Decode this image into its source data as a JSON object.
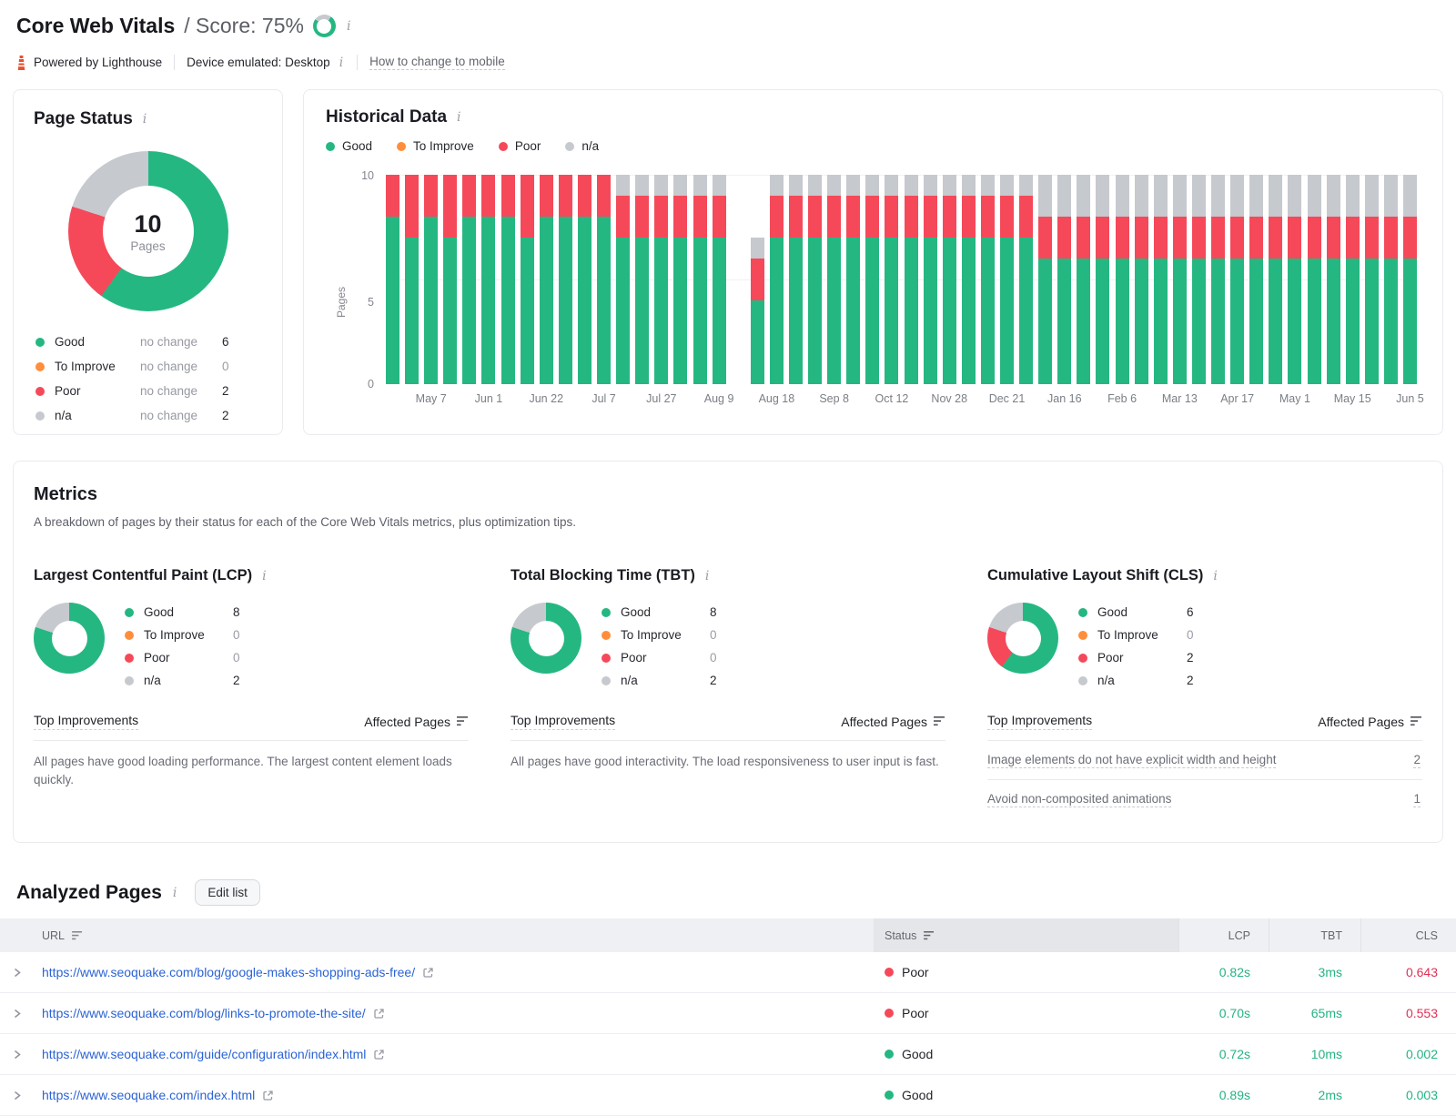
{
  "colors": {
    "good": "#25b782",
    "to_improve": "#ff8e3c",
    "poor": "#f5495a",
    "na": "#c6c9ce",
    "value_good": "#24b380",
    "value_poor": "#e03055",
    "link": "#2b63d4",
    "ring_track": "#d4d7db"
  },
  "header": {
    "title": "Core Web Vitals",
    "score_label": "/ Score: 75%",
    "score_percent": 75,
    "powered_by": "Powered by Lighthouse",
    "device": "Device emulated: Desktop",
    "mobile_link": "How to change to mobile"
  },
  "page_status": {
    "title": "Page Status",
    "legend": [
      {
        "status": "good",
        "label": "Good",
        "change": "no change",
        "value": "6"
      },
      {
        "status": "to_improve",
        "label": "To Improve",
        "change": "no change",
        "value": "0"
      },
      {
        "status": "poor",
        "label": "Poor",
        "change": "no change",
        "value": "2"
      },
      {
        "status": "na",
        "label": "n/a",
        "change": "no change",
        "value": "2"
      }
    ]
  },
  "historical": {
    "title": "Historical Data",
    "legend": [
      {
        "status": "good",
        "label": "Good"
      },
      {
        "status": "to_improve",
        "label": "To Improve"
      },
      {
        "status": "poor",
        "label": "Poor"
      },
      {
        "status": "na",
        "label": "n/a"
      }
    ]
  },
  "metrics": {
    "title": "Metrics",
    "subtitle": "A breakdown of pages by their status for each of the Core Web Vitals metrics, plus optimization tips.",
    "cards": [
      {
        "id": "lcp",
        "title": "Largest Contentful Paint (LCP)",
        "legend": [
          {
            "status": "good",
            "label": "Good",
            "value": "8"
          },
          {
            "status": "to_improve",
            "label": "To Improve",
            "value": "0"
          },
          {
            "status": "poor",
            "label": "Poor",
            "value": "0"
          },
          {
            "status": "na",
            "label": "n/a",
            "value": "2"
          }
        ],
        "improvements_header": "Top Improvements",
        "affected_header": "Affected Pages",
        "note": "All pages have good loading performance. The largest content element loads quickly.",
        "improvements": []
      },
      {
        "id": "tbt",
        "title": "Total Blocking Time (TBT)",
        "legend": [
          {
            "status": "good",
            "label": "Good",
            "value": "8"
          },
          {
            "status": "to_improve",
            "label": "To Improve",
            "value": "0"
          },
          {
            "status": "poor",
            "label": "Poor",
            "value": "0"
          },
          {
            "status": "na",
            "label": "n/a",
            "value": "2"
          }
        ],
        "improvements_header": "Top Improvements",
        "affected_header": "Affected Pages",
        "note": "All pages have good interactivity. The load responsiveness to user input is fast.",
        "improvements": []
      },
      {
        "id": "cls",
        "title": "Cumulative Layout Shift (CLS)",
        "legend": [
          {
            "status": "good",
            "label": "Good",
            "value": "6"
          },
          {
            "status": "to_improve",
            "label": "To Improve",
            "value": "0"
          },
          {
            "status": "poor",
            "label": "Poor",
            "value": "2"
          },
          {
            "status": "na",
            "label": "n/a",
            "value": "2"
          }
        ],
        "improvements_header": "Top Improvements",
        "affected_header": "Affected Pages",
        "note": null,
        "improvements": [
          {
            "label": "Image elements do not have explicit width and height",
            "pages": "2"
          },
          {
            "label": "Avoid non-composited animations",
            "pages": "1"
          }
        ]
      }
    ]
  },
  "analyzed": {
    "title": "Analyzed Pages",
    "edit_button": "Edit list",
    "columns": {
      "url": "URL",
      "status": "Status",
      "lcp": "LCP",
      "tbt": "TBT",
      "cls": "CLS"
    },
    "rows": [
      {
        "url": "https://www.seoquake.com/blog/google-makes-shopping-ads-free/",
        "status": "Poor",
        "status_tone": "poor",
        "lcp": "0.82s",
        "lcp_tone": "good",
        "tbt": "3ms",
        "tbt_tone": "good",
        "cls": "0.643",
        "cls_tone": "poor"
      },
      {
        "url": "https://www.seoquake.com/blog/links-to-promote-the-site/",
        "status": "Poor",
        "status_tone": "poor",
        "lcp": "0.70s",
        "lcp_tone": "good",
        "tbt": "65ms",
        "tbt_tone": "good",
        "cls": "0.553",
        "cls_tone": "poor"
      },
      {
        "url": "https://www.seoquake.com/guide/configuration/index.html",
        "status": "Good",
        "status_tone": "good",
        "lcp": "0.72s",
        "lcp_tone": "good",
        "tbt": "10ms",
        "tbt_tone": "good",
        "cls": "0.002",
        "cls_tone": "good"
      },
      {
        "url": "https://www.seoquake.com/index.html",
        "status": "Good",
        "status_tone": "good",
        "lcp": "0.89s",
        "lcp_tone": "good",
        "tbt": "2ms",
        "tbt_tone": "good",
        "cls": "0.003",
        "cls_tone": "good"
      }
    ]
  },
  "chart_data": {
    "score_ring": {
      "type": "pie",
      "segments": [
        {
          "status": "good",
          "label": "Score",
          "value": 75
        },
        {
          "status": "na",
          "label": "Remainder",
          "value": 25
        }
      ]
    },
    "page_status_donut": {
      "type": "pie",
      "title": "Page Status",
      "center_value": "10",
      "center_label": "Pages",
      "segments": [
        {
          "status": "good",
          "label": "Good",
          "value": 6
        },
        {
          "status": "to_improve",
          "label": "To Improve",
          "value": 0
        },
        {
          "status": "poor",
          "label": "Poor",
          "value": 2
        },
        {
          "status": "na",
          "label": "n/a",
          "value": 2
        }
      ]
    },
    "lcp_donut": {
      "type": "pie",
      "title": "Largest Contentful Paint (LCP)",
      "segments": [
        {
          "status": "good",
          "label": "Good",
          "value": 8
        },
        {
          "status": "to_improve",
          "label": "To Improve",
          "value": 0
        },
        {
          "status": "poor",
          "label": "Poor",
          "value": 0
        },
        {
          "status": "na",
          "label": "n/a",
          "value": 2
        }
      ]
    },
    "tbt_donut": {
      "type": "pie",
      "title": "Total Blocking Time (TBT)",
      "segments": [
        {
          "status": "good",
          "label": "Good",
          "value": 8
        },
        {
          "status": "to_improve",
          "label": "To Improve",
          "value": 0
        },
        {
          "status": "poor",
          "label": "Poor",
          "value": 0
        },
        {
          "status": "na",
          "label": "n/a",
          "value": 2
        }
      ]
    },
    "cls_donut": {
      "type": "pie",
      "title": "Cumulative Layout Shift (CLS)",
      "segments": [
        {
          "status": "good",
          "label": "Good",
          "value": 6
        },
        {
          "status": "to_improve",
          "label": "To Improve",
          "value": 0
        },
        {
          "status": "poor",
          "label": "Poor",
          "value": 2
        },
        {
          "status": "na",
          "label": "n/a",
          "value": 2
        }
      ]
    },
    "historical_stacked_bar": {
      "type": "bar",
      "stacked": true,
      "title": "Historical Data",
      "xlabel": "",
      "ylabel": "Pages",
      "ylim": [
        0,
        10
      ],
      "yticks": [
        "0",
        "5",
        "10"
      ],
      "grid": true,
      "legend_position": "top",
      "x_labels": [
        "May 7",
        "Jun 1",
        "Jun 22",
        "Jul 7",
        "Jul 27",
        "Aug 9",
        "Aug 18",
        "Sep 8",
        "Oct 12",
        "Nov 28",
        "Dec 21",
        "Jan 16",
        "Feb 6",
        "Mar 13",
        "Apr 17",
        "May 1",
        "May 15",
        "Jun 5"
      ],
      "x_tick_every": 3,
      "series": [
        {
          "name": "Good",
          "status": "good",
          "values": [
            8,
            7,
            8,
            7,
            8,
            8,
            8,
            7,
            8,
            8,
            8,
            8,
            7,
            7,
            7,
            7,
            7,
            7,
            0,
            4,
            7,
            7,
            7,
            7,
            7,
            7,
            7,
            7,
            7,
            7,
            7,
            7,
            7,
            7,
            6,
            6,
            6,
            6,
            6,
            6,
            6,
            6,
            6,
            6,
            6,
            6,
            6,
            6,
            6,
            6,
            6,
            6,
            6,
            6
          ]
        },
        {
          "name": "To Improve",
          "status": "to_improve",
          "values": [
            0,
            0,
            0,
            0,
            0,
            0,
            0,
            0,
            0,
            0,
            0,
            0,
            0,
            0,
            0,
            0,
            0,
            0,
            0,
            0,
            0,
            0,
            0,
            0,
            0,
            0,
            0,
            0,
            0,
            0,
            0,
            0,
            0,
            0,
            0,
            0,
            0,
            0,
            0,
            0,
            0,
            0,
            0,
            0,
            0,
            0,
            0,
            0,
            0,
            0,
            0,
            0,
            0,
            0
          ]
        },
        {
          "name": "Poor",
          "status": "poor",
          "values": [
            2,
            3,
            2,
            3,
            2,
            2,
            2,
            3,
            2,
            2,
            2,
            2,
            2,
            2,
            2,
            2,
            2,
            2,
            0,
            2,
            2,
            2,
            2,
            2,
            2,
            2,
            2,
            2,
            2,
            2,
            2,
            2,
            2,
            2,
            2,
            2,
            2,
            2,
            2,
            2,
            2,
            2,
            2,
            2,
            2,
            2,
            2,
            2,
            2,
            2,
            2,
            2,
            2,
            2
          ]
        },
        {
          "name": "n/a",
          "status": "na",
          "values": [
            0,
            0,
            0,
            0,
            0,
            0,
            0,
            0,
            0,
            0,
            0,
            0,
            1,
            1,
            1,
            1,
            1,
            1,
            0,
            1,
            1,
            1,
            1,
            1,
            1,
            1,
            1,
            1,
            1,
            1,
            1,
            1,
            1,
            1,
            2,
            2,
            2,
            2,
            2,
            2,
            2,
            2,
            2,
            2,
            2,
            2,
            2,
            2,
            2,
            2,
            2,
            2,
            2,
            2
          ]
        }
      ]
    }
  }
}
